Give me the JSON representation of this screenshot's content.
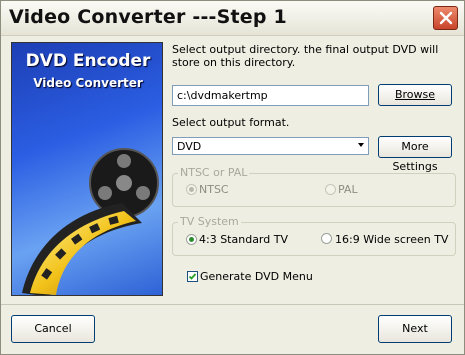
{
  "window": {
    "title": "Video Converter ---Step 1"
  },
  "banner": {
    "line1": "DVD Encoder",
    "line2": "Video Converter"
  },
  "output_dir": {
    "label": "Select output directory. the final output DVD will store on this directory.",
    "value": "c:\\dvdmakertmp",
    "browse_label": "Browse"
  },
  "output_format": {
    "label": "Select output format.",
    "selected": "DVD",
    "more_settings_label": "More Settings"
  },
  "ntsc_pal": {
    "legend": "NTSC or PAL",
    "options": [
      "NTSC",
      "PAL"
    ],
    "selected": "NTSC"
  },
  "tv_system": {
    "legend": "TV System",
    "options": [
      "4:3 Standard TV",
      "16:9 Wide screen TV"
    ],
    "selected": "4:3 Standard TV"
  },
  "generate_menu": {
    "label": "Generate DVD Menu",
    "checked": true
  },
  "footer": {
    "cancel_label": "Cancel",
    "next_label": "Next"
  },
  "colors": {
    "banner_blue": "#2b5ee3",
    "close_red": "#c8442a",
    "radio_green": "#2e8b2e"
  }
}
